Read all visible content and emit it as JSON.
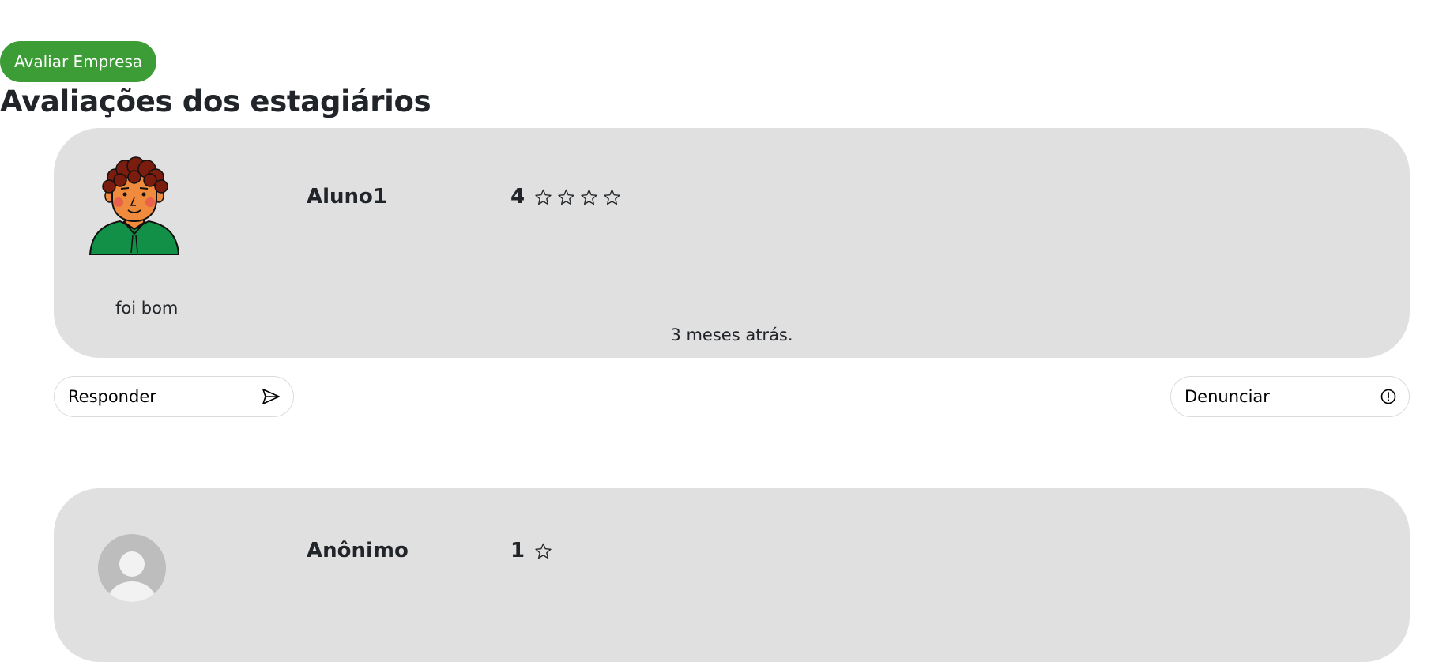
{
  "actions": {
    "rate_company_label": "Avaliar Empresa"
  },
  "section": {
    "title": "Avaliações dos estagiários"
  },
  "reviews": [
    {
      "author": "Aluno1",
      "score": "4",
      "stars": 4,
      "comment": "foi bom",
      "time_ago": "3 meses atrás.",
      "avatar_icon": "student-avatar-illustration"
    },
    {
      "author": "Anônimo",
      "score": "1",
      "stars": 1,
      "avatar_icon": "anonymous-user-icon"
    }
  ],
  "review_actions": {
    "reply_label": "Responder",
    "reply_icon": "send-icon",
    "report_label": "Denunciar",
    "report_icon": "alert-circle-icon"
  },
  "colors": {
    "primary_green": "#3c9d36",
    "card_background": "#e0e0e0",
    "text": "#212529"
  }
}
